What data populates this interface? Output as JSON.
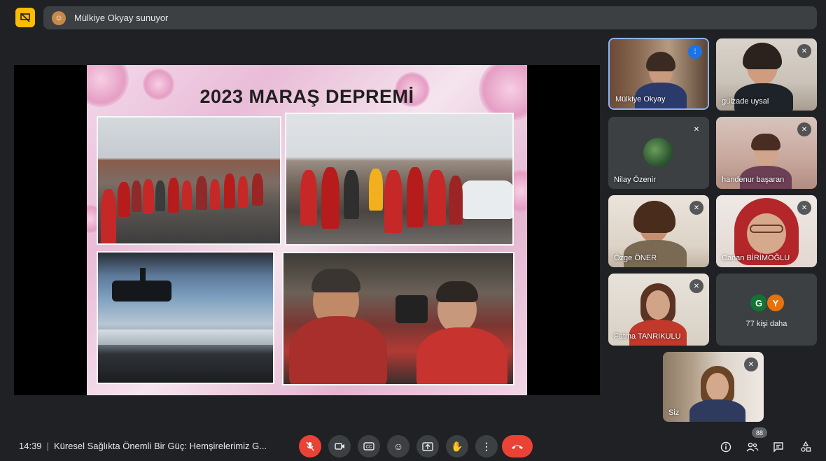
{
  "presenting_banner": {
    "text": "Mülkiye Okyay sunuyor"
  },
  "slide": {
    "title": "2023 MARAŞ DEPREMİ"
  },
  "participants": [
    {
      "name": "Mülkiye Okyay",
      "speaking": true
    },
    {
      "name": "gülzade uysal",
      "muted": true
    },
    {
      "name": "Nilay Özenir",
      "muted": true
    },
    {
      "name": "handenur başaran",
      "muted": true
    },
    {
      "name": "Özge ÖNER",
      "muted": true
    },
    {
      "name": "Canan BİRİMOĞLU",
      "muted": true
    },
    {
      "name": "Fatma TANRIKULU",
      "muted": true
    },
    {
      "name": "Siz",
      "muted": true
    }
  ],
  "more_participants": {
    "initials": [
      "G",
      "Y"
    ],
    "colors": [
      "#137333",
      "#e8710a"
    ],
    "label": "77 kişi daha"
  },
  "bottom_bar": {
    "time": "14:39",
    "meeting_title": "Küresel Sağlıkta Önemli Bir Güç: Hemşirelerimiz G...",
    "people_count": "88"
  },
  "colors": {
    "background": "#202124",
    "tile": "#3c4043",
    "accent_red": "#ea4335",
    "accent_blue": "#1a73e8",
    "present_icon": "#fbbc04"
  }
}
